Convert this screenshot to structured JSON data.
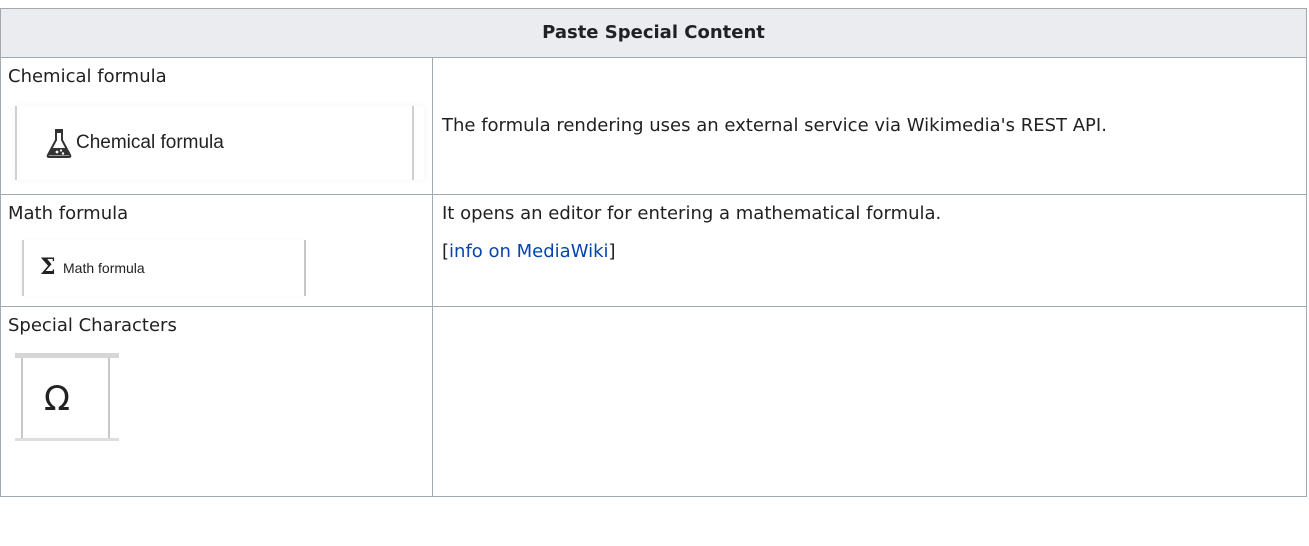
{
  "table": {
    "header": "Paste Special Content",
    "rows": [
      {
        "name": "Chemical formula",
        "button_label": "Chemical formula",
        "button_icon": "flask-icon",
        "description": "The formula rendering uses an external service via Wikimedia's REST API."
      },
      {
        "name": "Math formula",
        "button_label": "Math formula",
        "button_icon": "sigma-icon",
        "button_glyph": "Σ",
        "description": "It opens an editor for entering a mathematical formula.",
        "link_open": "[",
        "link_text": "info on MediaWiki",
        "link_close": "]"
      },
      {
        "name": "Special Characters",
        "button_icon": "omega-icon",
        "button_glyph": "Ω",
        "description": ""
      }
    ]
  },
  "colors": {
    "header_bg": "#eaecf0",
    "border": "#a2a9b1",
    "link": "#0645ad",
    "text": "#202122"
  }
}
